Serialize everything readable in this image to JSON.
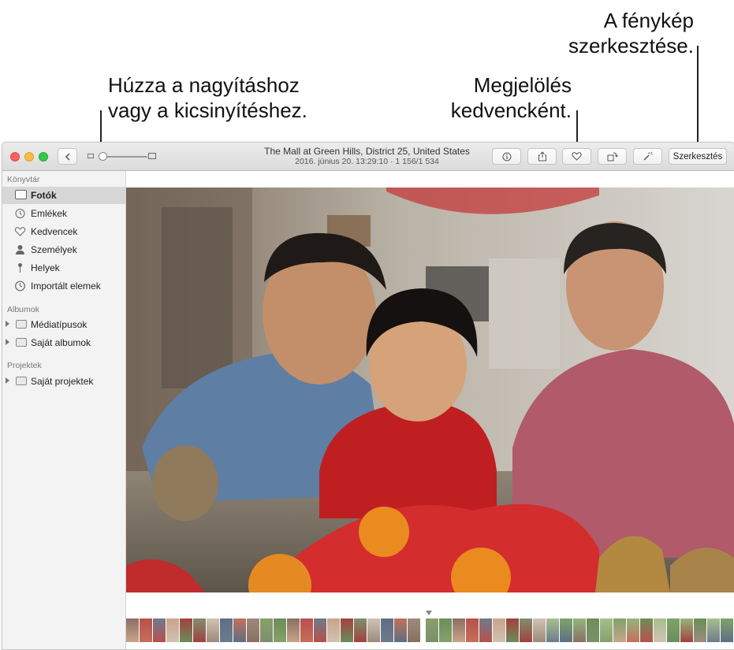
{
  "callouts": {
    "zoom": {
      "line1": "Húzza a nagyításhoz",
      "line2": "vagy a kicsinyítéshez."
    },
    "favorite": {
      "line1": "Megjelölés",
      "line2": "kedvencként."
    },
    "edit": {
      "line1": "A fénykép",
      "line2": "szerkesztése."
    }
  },
  "titlebar": {
    "title": "The Mall at Green Hills, District 25, United States",
    "subtitle": "2016. június 20. 13:29:10   ·   1 156/1 534",
    "edit_label": "Szerkesztés"
  },
  "sidebar": {
    "library_header": "Könyvtár",
    "library_items": [
      {
        "label": "Fotók",
        "icon": "photos-icon",
        "selected": true
      },
      {
        "label": "Emlékek",
        "icon": "memories-icon",
        "selected": false
      },
      {
        "label": "Kedvencek",
        "icon": "heart-icon",
        "selected": false
      },
      {
        "label": "Személyek",
        "icon": "person-icon",
        "selected": false
      },
      {
        "label": "Helyek",
        "icon": "pin-icon",
        "selected": false
      },
      {
        "label": "Importált elemek",
        "icon": "clock-icon",
        "selected": false
      }
    ],
    "albums_header": "Albumok",
    "album_items": [
      {
        "label": "Médiatípusok"
      },
      {
        "label": "Saját albumok"
      }
    ],
    "projects_header": "Projektek",
    "project_items": [
      {
        "label": "Saját projektek"
      }
    ]
  },
  "colors": {
    "sidebar_bg": "#f3f3f3",
    "selection": "#d7d7d7",
    "close": "#fc605c",
    "minimize": "#fdbc40",
    "zoom": "#34c84a"
  }
}
